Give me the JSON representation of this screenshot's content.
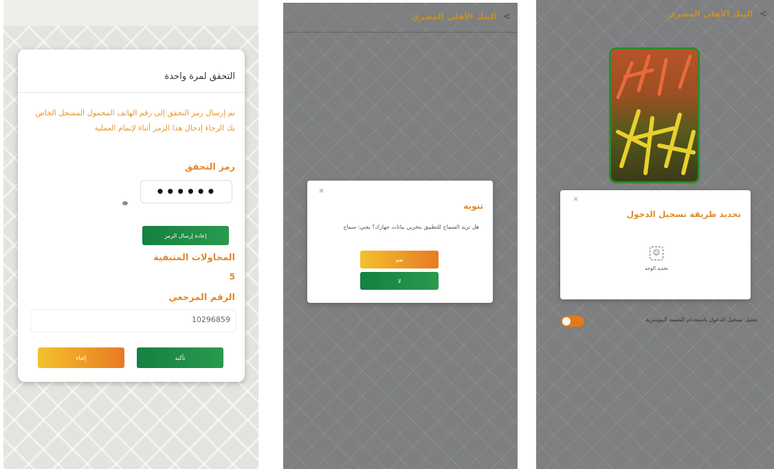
{
  "screens": {
    "otp": {
      "title": "التحقق لمرة واحدة",
      "message": "تم إرسال رمز التحقق إلى رقم الهاتف المحمول المسجل الخاص بك الرجاء إدخال هذا الرمز أثناء لإتمام العملية",
      "code_label": "رمز التحقق",
      "code_value": "••••••",
      "resend_button": "إعادة إرسال الرمز",
      "attempts_label": "المحاولات المتبقية",
      "attempts_value": "5",
      "reference_label": "الرقم المرجعي",
      "reference_value": "10296859",
      "confirm_button": "تأكيد",
      "cancel_button": "إلغاء"
    },
    "alert": {
      "header_title": "البنك الأهلي المصري",
      "dialog_title": "تنويه",
      "dialog_message": "هل تريد السماح للتطبيق بتخزين بيانات جهازك؟ يعني: سماح",
      "yes_button": "نعم",
      "no_button": "لا"
    },
    "login": {
      "header_title": "البنك الأهلي المصري",
      "dialog_title": "تحديد طريقة تسجيل الدخول",
      "face_option_label": "تحديد الوجه",
      "biometric_toggle_label": "تفعيل تسجيل الدخول باستخدام البصمة البيومترية",
      "biometric_toggle_on": true
    }
  },
  "colors": {
    "accent_orange": "#e08a2a",
    "green": "#1a8a45",
    "gold_title": "#c5902b"
  },
  "icons": {
    "back": "chevron-left-icon",
    "close": "close-icon",
    "face": "face-id-icon",
    "eye": "eye-icon"
  }
}
